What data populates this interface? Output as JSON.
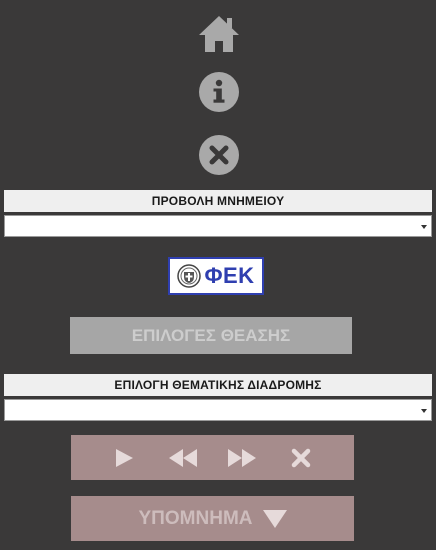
{
  "toolbar": {
    "home_icon": "home-icon",
    "info_icon": "info-icon",
    "close_icon": "close-icon"
  },
  "monument": {
    "label": "ΠΡΟΒΟΛΗ ΜΝΗΜΕΙΟΥ",
    "selected_value": ""
  },
  "fek": {
    "text": "ΦΕΚ"
  },
  "view_options": {
    "label": "ΕΠΙΛΟΓΕΣ ΘΕΑΣΗΣ"
  },
  "route": {
    "label": "ΕΠΙΛΟΓΗ ΘΕΜΑΤΙΚΗΣ ΔΙΑΔΡΟΜΗΣ",
    "selected_value": ""
  },
  "playback": {
    "icons": [
      "play-icon",
      "rewind-icon",
      "fast-forward-icon",
      "stop-icon"
    ]
  },
  "legend": {
    "label": "ΥΠΟΜΝΗΜΑ"
  },
  "colors": {
    "background": "#3a3939",
    "icon_gray": "#a9a9a9",
    "fek_blue": "#2f3fb0",
    "playback_bg": "#a68c8c"
  }
}
